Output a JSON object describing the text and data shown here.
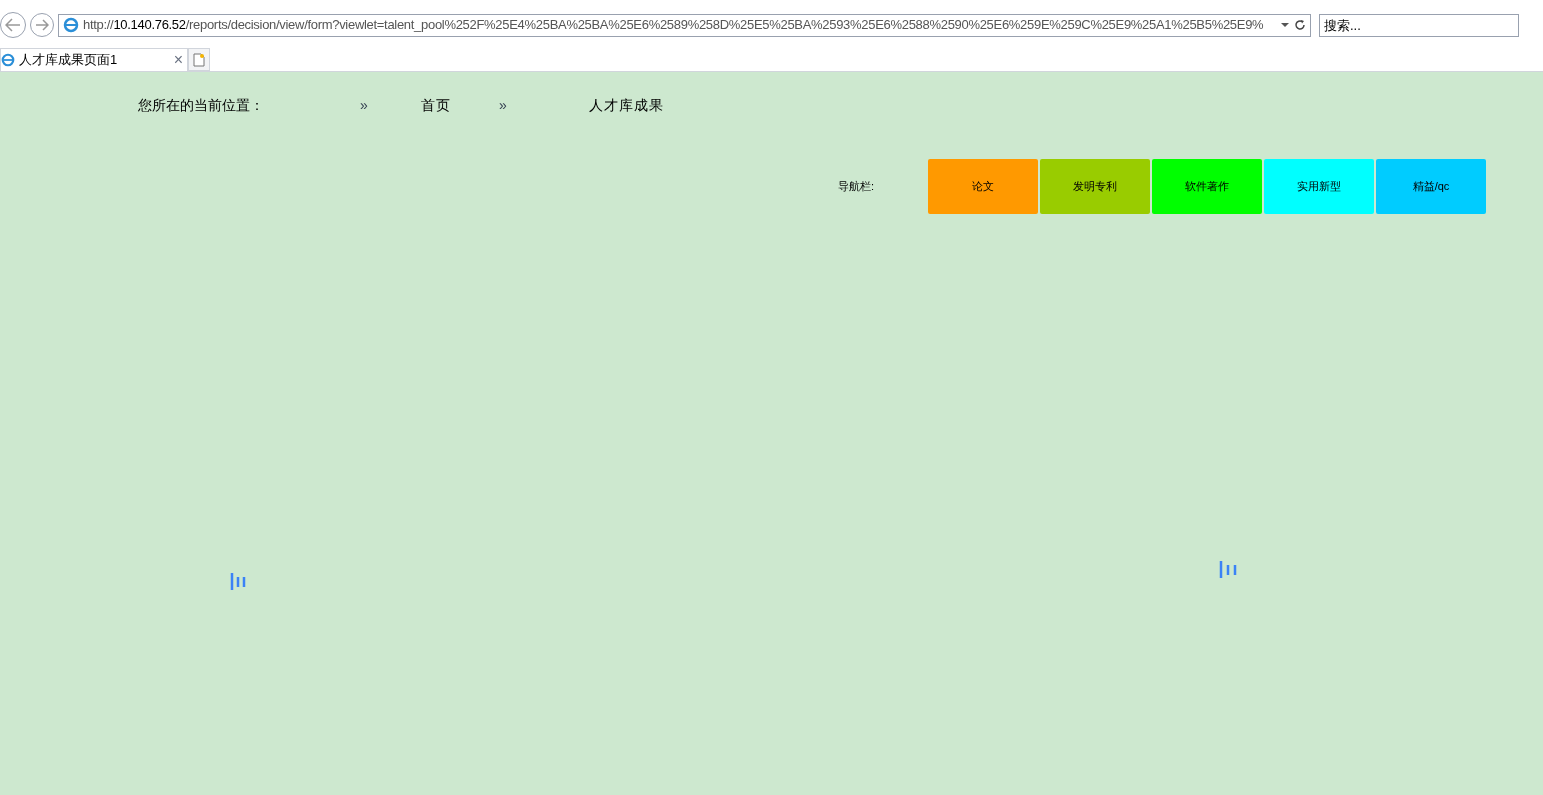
{
  "browser": {
    "url_scheme": "http://",
    "url_host": "10.140.76.52",
    "url_path": "/reports/decision/view/form?viewlet=talent_pool%252F%25E4%25BA%25BA%25E6%2589%258D%25E5%25BA%2593%25E6%2588%2590%25E6%259E%259C%25E9%25A1%25B5%25E9%",
    "search_placeholder": "搜索...",
    "tab_title": "人才库成果页面1",
    "tab_close": "×"
  },
  "breadcrumb": {
    "label": "您所在的当前位置：",
    "items": [
      {
        "separator": "»",
        "text": "首页"
      },
      {
        "separator": "»",
        "text": "人才库成果"
      }
    ]
  },
  "nav": {
    "label": "导航栏:",
    "buttons": [
      {
        "text": "论文",
        "color": "#ff9900"
      },
      {
        "text": "发明专利",
        "color": "#99cc00"
      },
      {
        "text": "软件著作",
        "color": "#00ff00"
      },
      {
        "text": "实用新型",
        "color": "#00ffff"
      },
      {
        "text": "精益/qc",
        "color": "#00ccff"
      }
    ]
  }
}
